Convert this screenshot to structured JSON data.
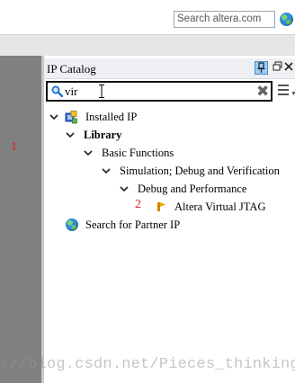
{
  "toolbar": {
    "search_placeholder": "Search altera.com"
  },
  "left_pane": {
    "annotation": "1"
  },
  "panel": {
    "title": "IP Catalog",
    "search_value": "vir"
  },
  "tree": {
    "installed_ip": "Installed IP",
    "library": "Library",
    "basic_functions": "Basic Functions",
    "simulation": "Simulation; Debug and Verification",
    "debug_performance": "Debug and Performance",
    "altera_virtual_jtag": "Altera Virtual JTAG",
    "partner_ip": "Search for Partner IP",
    "annotation": "2"
  },
  "watermark": "://blog.csdn.net/Pieces_thinking",
  "colors": {
    "left_pane": "#808080",
    "annotation_red": "#e02020",
    "pin_blue": "#9ecbf0"
  }
}
